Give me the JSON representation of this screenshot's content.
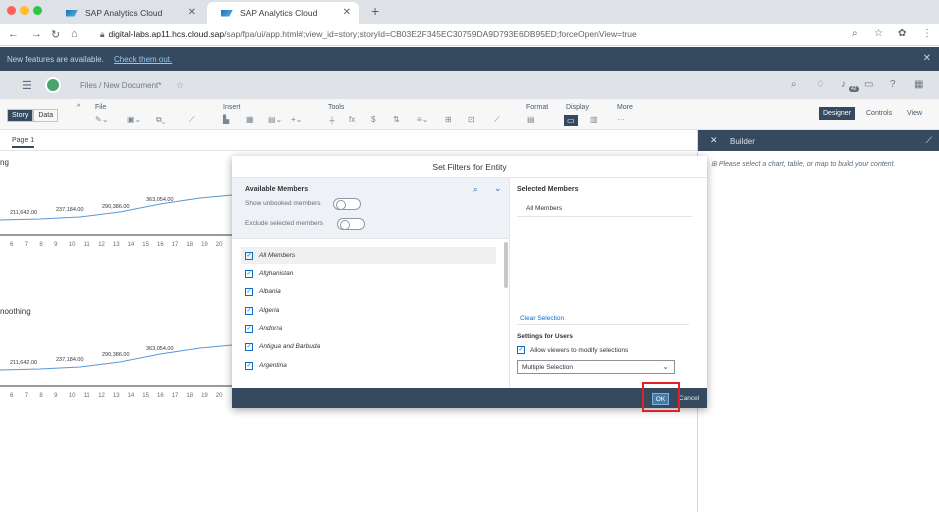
{
  "browser": {
    "tabs": [
      {
        "title": "SAP Analytics Cloud",
        "active": false
      },
      {
        "title": "SAP Analytics Cloud",
        "active": true
      }
    ],
    "url_host": "digital-labs.ap11.hcs.cloud.sap",
    "url_path": "/sap/fpa/ui/app.html#;view_id=story;storyId=CB03E2F345EC30759DA9D793E6DB95ED;forceOpenView=true"
  },
  "notification": {
    "message": "New features are available.",
    "link": "Check them out."
  },
  "shell": {
    "breadcrumb": "Files  /  New Document*",
    "badge": "42"
  },
  "toolbar": {
    "story_label": "Story",
    "data_label": "Data",
    "file_label": "File",
    "insert_label": "Insert",
    "tools_label": "Tools",
    "format_label": "Format",
    "display_label": "Display",
    "more_label": "More",
    "designer_label": "Designer",
    "controls_label": "Controls",
    "view_label": "View"
  },
  "page": {
    "tab_label": "Page 1"
  },
  "charts": [
    {
      "title_fragment": "ng",
      "labels": [
        "211,642.00",
        "237,184.00",
        "290,386.00",
        "363,054.00"
      ],
      "ticks": [
        "6",
        "7",
        "8",
        "9",
        "10",
        "11",
        "12",
        "13",
        "14",
        "15",
        "16",
        "17",
        "18",
        "19",
        "20"
      ]
    },
    {
      "title_fragment": "noothing",
      "labels": [
        "211,642.00",
        "237,184.00",
        "290,386.00",
        "363,054.00"
      ],
      "ticks": [
        "6",
        "7",
        "8",
        "9",
        "10",
        "11",
        "12",
        "13",
        "14",
        "15",
        "16",
        "17",
        "18",
        "19",
        "20"
      ]
    }
  ],
  "builder": {
    "title": "Builder",
    "message": "Please select a chart, table, or map to build your content."
  },
  "dialog": {
    "title": "Set Filters for Entity",
    "available_title": "Available Members",
    "show_unbooked": "Show unbooked members",
    "exclude_selected": "Exclude selected members",
    "members": [
      "All Members",
      "Afghanistan",
      "Albania",
      "Algeria",
      "Andorra",
      "Antigua and Barbuda",
      "Argentina"
    ],
    "selected_title": "Selected Members",
    "selected_items": [
      "All Members"
    ],
    "clear_selection": "Clear Selection",
    "settings_title": "Settings for Users",
    "allow_viewers": "Allow viewers to modify selections",
    "selection_mode": "Multiple Selection",
    "ok_label": "OK",
    "cancel_label": "Cancel"
  },
  "colors": {
    "shell_dark": "#354a5f",
    "accent_blue": "#0a6ed1",
    "highlight_red": "#e0202a"
  }
}
